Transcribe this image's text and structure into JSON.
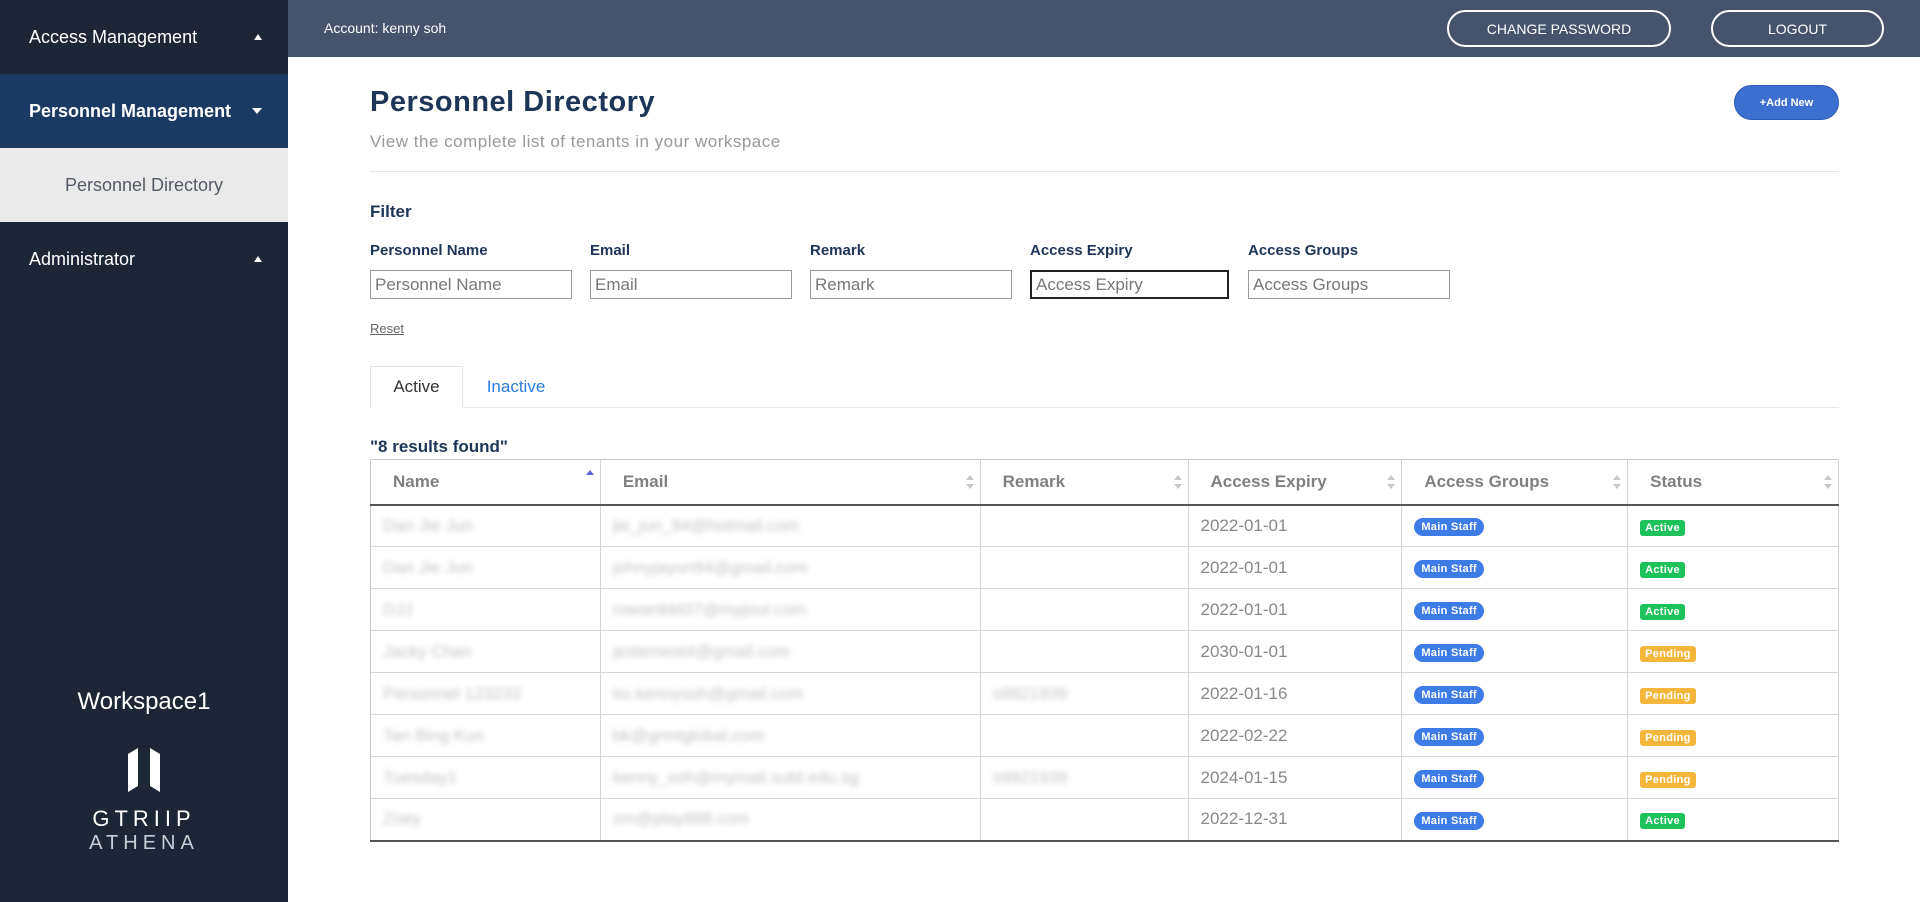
{
  "sidebar": {
    "items": [
      {
        "label": "Access Management"
      },
      {
        "label": "Personnel Management"
      },
      {
        "label": "Personnel Directory"
      },
      {
        "label": "Administrator"
      }
    ],
    "workspace": "Workspace1",
    "logo_line1": "GTRIIP",
    "logo_line2": "ATHENA"
  },
  "topbar": {
    "account": "Account: kenny soh",
    "change_password": "CHANGE PASSWORD",
    "logout": "LOGOUT"
  },
  "header": {
    "title": "Personnel Directory",
    "subtitle": "View the complete list of tenants in your workspace",
    "add_new": "+Add New"
  },
  "filter": {
    "title": "Filter",
    "fields": [
      {
        "label": "Personnel Name",
        "placeholder": "Personnel Name"
      },
      {
        "label": "Email",
        "placeholder": "Email"
      },
      {
        "label": "Remark",
        "placeholder": "Remark"
      },
      {
        "label": "Access Expiry",
        "placeholder": "Access Expiry"
      },
      {
        "label": "Access Groups",
        "placeholder": "Access Groups"
      }
    ],
    "reset": "Reset"
  },
  "tabs": [
    {
      "label": "Active"
    },
    {
      "label": "Inactive"
    }
  ],
  "results_text": "\"8 results found\"",
  "table": {
    "columns": [
      "Name",
      "Email",
      "Remark",
      "Access Expiry",
      "Access Groups",
      "Status"
    ],
    "rows": [
      {
        "name": "Dan Jie Jun",
        "email": "jie_jun_94@hotmail.com",
        "remark": "",
        "expiry": "2022-01-01",
        "group": "Main Staff",
        "status": "Active"
      },
      {
        "name": "Dan Jie Jun",
        "email": "johnyjayun94@gmail.com",
        "remark": "",
        "expiry": "2022-01-01",
        "group": "Main Staff",
        "status": "Active"
      },
      {
        "name": "DJJ",
        "email": "rowarddd37@myjour.com",
        "remark": "",
        "expiry": "2022-01-01",
        "group": "Main Staff",
        "status": "Active"
      },
      {
        "name": "Jacky Chan",
        "email": "jestemest4@gmail.com",
        "remark": "",
        "expiry": "2030-01-01",
        "group": "Main Staff",
        "status": "Pending"
      },
      {
        "name": "Personnel 123233",
        "email": "ko.kennysoh@gmail.com",
        "remark": "s9921939",
        "expiry": "2022-01-16",
        "group": "Main Staff",
        "status": "Pending"
      },
      {
        "name": "Tan Bing Kun",
        "email": "bk@grmtglobal.com",
        "remark": "",
        "expiry": "2022-02-22",
        "group": "Main Staff",
        "status": "Pending"
      },
      {
        "name": "Tuesday1",
        "email": "kenny_soh@mymail.sutd.edu.sg",
        "remark": "s9921939",
        "expiry": "2024-01-15",
        "group": "Main Staff",
        "status": "Pending"
      },
      {
        "name": "Zoey",
        "email": "zm@play888.com",
        "remark": "",
        "expiry": "2022-12-31",
        "group": "Main Staff",
        "status": "Active"
      }
    ]
  },
  "colors": {
    "sidebar_bg": "#1d2637",
    "topbar_bg": "#46536d",
    "title": "#1d3557",
    "accent_blue": "#3d6fd1",
    "active_green": "#1ec25a",
    "pending_orange": "#f5b63c"
  }
}
